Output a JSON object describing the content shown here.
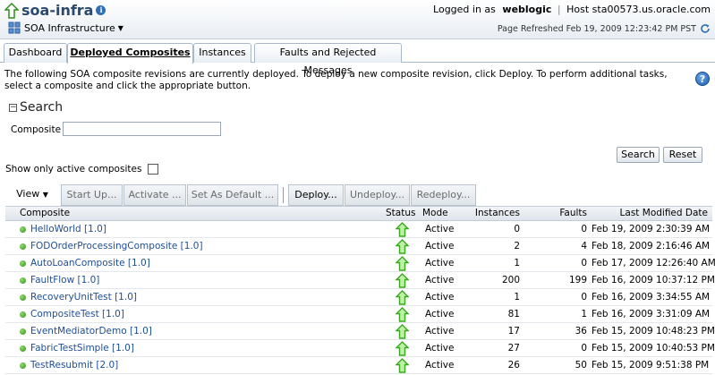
{
  "header": {
    "title": "soa-infra",
    "subtitle": "SOA Infrastructure",
    "logged_in_label": "Logged in as",
    "user": "weblogic",
    "host_label": "Host",
    "host": "sta00573.us.oracle.com",
    "refreshed": "Page Refreshed Feb 19, 2009 12:23:42 PM PST"
  },
  "tabs": [
    {
      "label": "Dashboard"
    },
    {
      "label": "Deployed Composites"
    },
    {
      "label": "Instances"
    },
    {
      "label": "Faults and Rejected Messages"
    }
  ],
  "description": "The following SOA composite revisions are currently deployed. To deploy a new composite revision, click Deploy. To perform additional tasks, select a composite and click the appropriate button.",
  "search": {
    "heading": "Search",
    "composite_label": "Composite",
    "composite_value": "",
    "search_button": "Search",
    "reset_button": "Reset",
    "active_only_label": "Show only active composites"
  },
  "toolbar": {
    "view": "View",
    "start_up": "Start Up...",
    "activate": "Activate ...",
    "set_default": "Set As Default ...",
    "deploy": "Deploy...",
    "undeploy": "Undeploy...",
    "redeploy": "Redeploy..."
  },
  "table": {
    "columns": [
      "Composite",
      "Status",
      "Mode",
      "Instances",
      "Faults",
      "Last Modified Date"
    ],
    "rows": [
      {
        "composite": "HelloWorld [1.0]",
        "mode": "Active",
        "instances": "0",
        "faults": "0",
        "modified": "Feb 19, 2009 2:30:39 AM"
      },
      {
        "composite": "FODOrderProcessingComposite [1.0]",
        "mode": "Active",
        "instances": "2",
        "faults": "4",
        "modified": "Feb 18, 2009 2:16:46 AM"
      },
      {
        "composite": "AutoLoanComposite [1.0]",
        "mode": "Active",
        "instances": "1",
        "faults": "0",
        "modified": "Feb 17, 2009 12:26:40 AM"
      },
      {
        "composite": "FaultFlow [1.0]",
        "mode": "Active",
        "instances": "200",
        "faults": "199",
        "modified": "Feb 16, 2009 10:37:12 PM"
      },
      {
        "composite": "RecoveryUnitTest [1.0]",
        "mode": "Active",
        "instances": "1",
        "faults": "0",
        "modified": "Feb 16, 2009 3:34:55 AM"
      },
      {
        "composite": "CompositeTest [1.0]",
        "mode": "Active",
        "instances": "81",
        "faults": "1",
        "modified": "Feb 16, 2009 3:31:09 AM"
      },
      {
        "composite": "EventMediatorDemo [1.0]",
        "mode": "Active",
        "instances": "17",
        "faults": "36",
        "modified": "Feb 15, 2009 10:48:23 PM"
      },
      {
        "composite": "FabricTestSimple [1.0]",
        "mode": "Active",
        "instances": "27",
        "faults": "0",
        "modified": "Feb 15, 2009 10:40:53 PM"
      },
      {
        "composite": "TestResubmit [2.0]",
        "mode": "Active",
        "instances": "26",
        "faults": "50",
        "modified": "Feb 15, 2009 9:51:38 PM"
      }
    ]
  },
  "colors": {
    "accent": "#2b4a6e",
    "link": "#1f4e96",
    "status_up": "#3aa81e"
  }
}
